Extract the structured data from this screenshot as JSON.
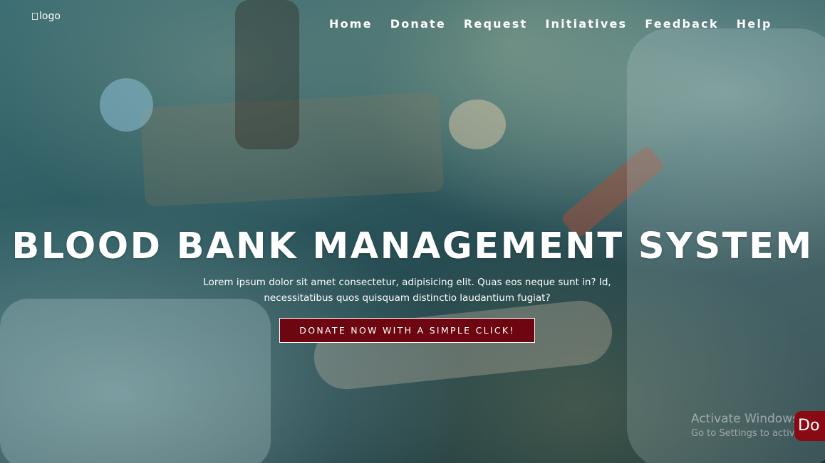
{
  "header": {
    "logo_alt": "logo",
    "nav": [
      {
        "label": "Home"
      },
      {
        "label": "Donate"
      },
      {
        "label": "Request"
      },
      {
        "label": "Initiatives"
      },
      {
        "label": "Feedback"
      },
      {
        "label": "Help"
      }
    ]
  },
  "hero": {
    "title": "BLOOD BANK MANAGEMENT SYSTEM",
    "subtitle_line1": "Lorem ipsum dolor sit amet consectetur, adipisicing elit. Quas eos neque sunt in? Id,",
    "subtitle_line2": "necessitatibus quos quisquam distinctio laudantium fugiat?",
    "cta_label": "DONATE NOW WITH A SIMPLE CLICK!"
  },
  "floating_button": {
    "label": "Do"
  },
  "watermark": {
    "line1": "Activate Windows",
    "line2": "Go to Settings to activate W"
  },
  "colors": {
    "cta_background": "#6d0610",
    "floating_button_background": "#8a0a14",
    "text": "#ffffff"
  }
}
